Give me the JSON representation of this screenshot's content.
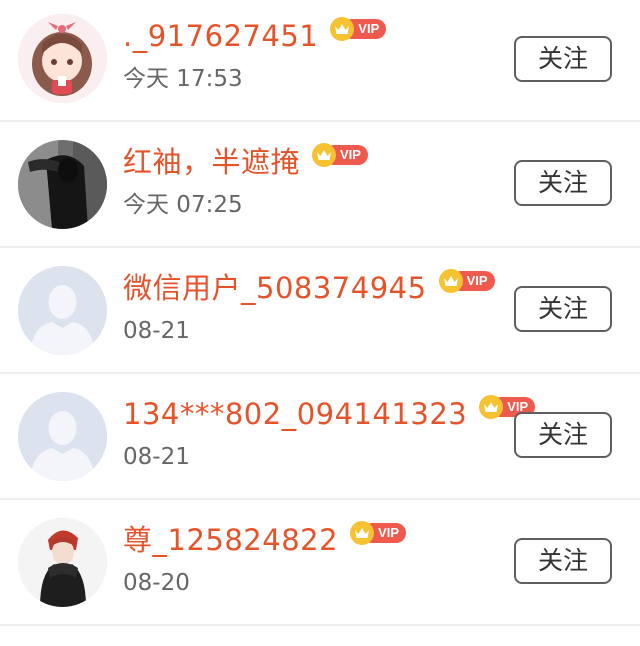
{
  "colors": {
    "name": "#e5532b",
    "vip_badge": "#ef5a4f",
    "crown": "#f6c230",
    "time": "#666666",
    "divider": "#eeeeee"
  },
  "users": [
    {
      "name": "._917627451",
      "vip": "VIP",
      "time": "今天 17:53",
      "follow_label": "关注",
      "avatar": "anime-girl-avatar"
    },
    {
      "name": "红袖，半遮掩",
      "vip": "VIP",
      "time": "今天 07:25",
      "follow_label": "关注",
      "avatar": "dark-photo-avatar"
    },
    {
      "name": "微信用户_508374945",
      "vip": "VIP",
      "time": "08-21",
      "follow_label": "关注",
      "avatar": "default-avatar"
    },
    {
      "name": "134***802_094141323",
      "vip": "VIP",
      "time": "08-21",
      "follow_label": "关注",
      "avatar": "default-avatar"
    },
    {
      "name": "尊_125824822",
      "vip": "VIP",
      "time": "08-20",
      "follow_label": "关注",
      "avatar": "anime-boy-avatar"
    }
  ]
}
